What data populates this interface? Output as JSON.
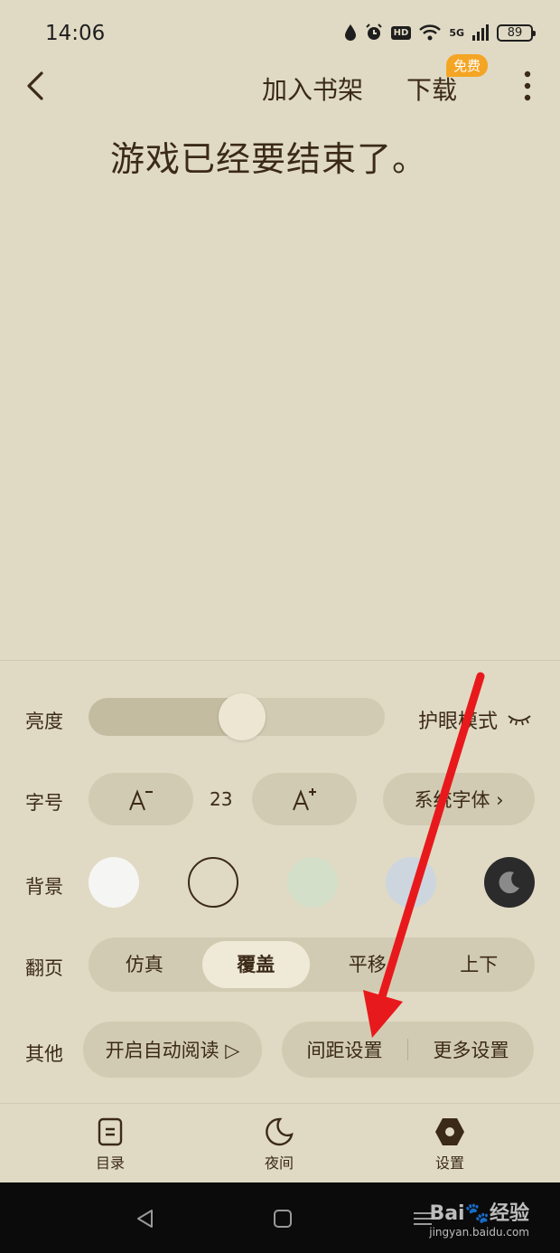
{
  "status_bar": {
    "time": "14:06",
    "network": "5G",
    "battery": "89"
  },
  "top_bar": {
    "add_to_shelf": "加入书架",
    "download": "下载",
    "free_badge": "免费"
  },
  "content": {
    "text": "游戏已经要结束了。"
  },
  "settings": {
    "brightness": {
      "label": "亮度",
      "level": 0.5,
      "eye_mode": "护眼模式"
    },
    "font": {
      "label": "字号",
      "size": "23",
      "system_font": "系统字体 ›"
    },
    "background": {
      "label": "背景",
      "swatches": [
        {
          "color": "#f5f5f3",
          "selected": false
        },
        {
          "color": "#e0dac4",
          "selected": true
        },
        {
          "color": "#d3dfc8",
          "selected": false
        },
        {
          "color": "#cdd6df",
          "selected": false
        },
        {
          "color": "#2b2b2b",
          "selected": false
        }
      ]
    },
    "page_turn": {
      "label": "翻页",
      "options": [
        "仿真",
        "覆盖",
        "平移",
        "上下"
      ],
      "selected": "覆盖"
    },
    "other": {
      "label": "其他",
      "auto_read": "开启自动阅读 ▷",
      "spacing": "间距设置",
      "more": "更多设置"
    }
  },
  "bottom_nav": {
    "toc": "目录",
    "night": "夜间",
    "settings": "设置"
  },
  "watermark": {
    "brand": "Bai🐾经验",
    "url": "jingyan.baidu.com"
  },
  "colors": {
    "background": "#e0dac4",
    "pill": "#d2cbb3",
    "text": "#3b2a17",
    "badge": "#f5a524",
    "annotation_arrow": "#e8191c"
  }
}
